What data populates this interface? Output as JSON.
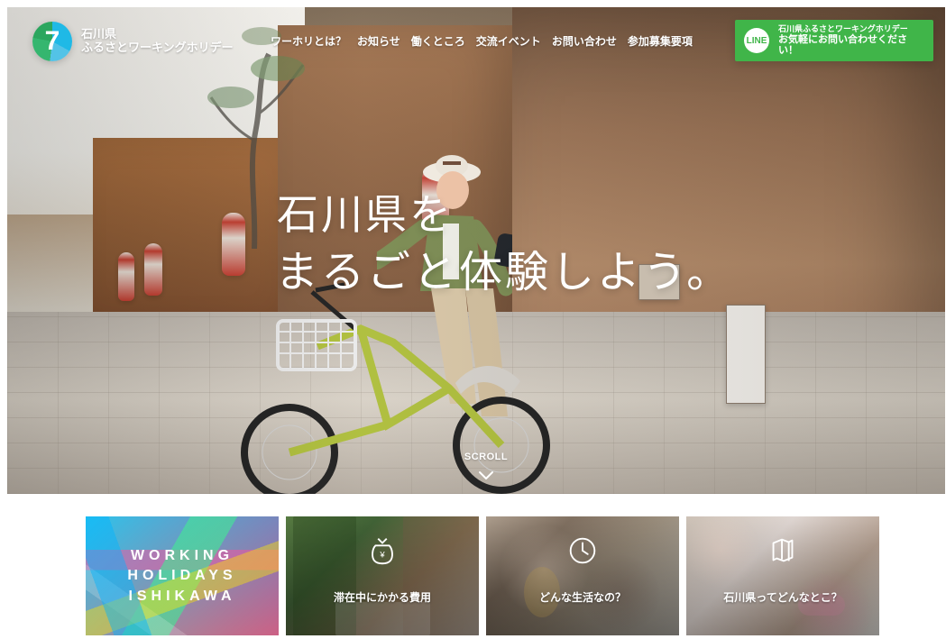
{
  "brand": {
    "title": "石川県",
    "subtitle": "ふるさとワーキングホリデー",
    "logo_icon": "logo-icon"
  },
  "nav": {
    "items": [
      {
        "label": "ワーホリとは？"
      },
      {
        "label": "お知らせ"
      },
      {
        "label": "働くところ"
      },
      {
        "label": "交流イベント"
      },
      {
        "label": "お問い合わせ"
      },
      {
        "label": "参加募集要項"
      }
    ]
  },
  "line_cta": {
    "badge": "LINE",
    "top": "石川県ふるさとワーキングホリデー",
    "bottom": "お気軽にお問い合わせください！"
  },
  "hero": {
    "headline_line1": "石川県を",
    "headline_line2": "まるごと体験しよう。",
    "scroll_label": "SCROLL"
  },
  "cards": [
    {
      "type": "feature",
      "lines": [
        "WORKING",
        "HOLIDAYS",
        "ISHIKAWA"
      ]
    },
    {
      "type": "photo",
      "label": "滞在中にかかる費用",
      "icon": "money-bag-icon"
    },
    {
      "type": "photo",
      "label": "どんな生活なの？",
      "icon": "clock-icon"
    },
    {
      "type": "photo",
      "label": "石川県ってどんなとこ？",
      "icon": "map-icon"
    }
  ],
  "colors": {
    "line_green": "#40b549",
    "white": "#ffffff"
  }
}
